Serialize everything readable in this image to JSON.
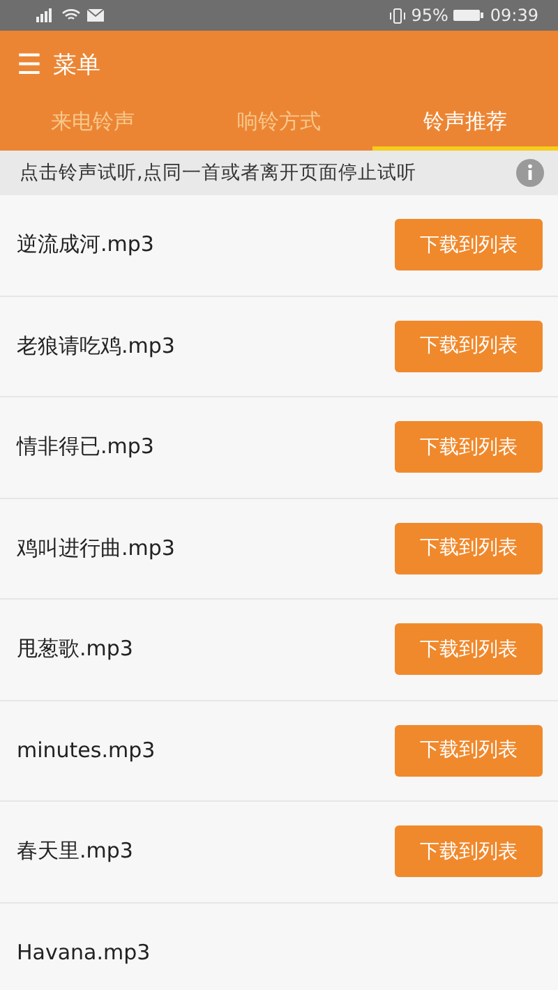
{
  "status_bar": {
    "battery_text": "95%",
    "time": "09:39"
  },
  "app_bar": {
    "menu_icon": "☰",
    "title": "菜单"
  },
  "tabs": [
    {
      "label": "来电铃声",
      "selected": false
    },
    {
      "label": "响铃方式",
      "selected": false
    },
    {
      "label": "铃声推荐",
      "selected": true
    }
  ],
  "notice": {
    "text": "点击铃声试听,点同一首或者离开页面停止试听"
  },
  "ringtones": [
    {
      "name": "逆流成河.mp3",
      "button": "下载到列表"
    },
    {
      "name": "老狼请吃鸡.mp3",
      "button": "下载到列表"
    },
    {
      "name": "情非得已.mp3",
      "button": "下载到列表"
    },
    {
      "name": "鸡叫进行曲.mp3",
      "button": "下载到列表"
    },
    {
      "name": "甩葱歌.mp3",
      "button": "下载到列表"
    },
    {
      "name": "minutes.mp3",
      "button": "下载到列表"
    },
    {
      "name": "春天里.mp3",
      "button": "下载到列表"
    },
    {
      "name": "Havana.mp3"
    }
  ]
}
